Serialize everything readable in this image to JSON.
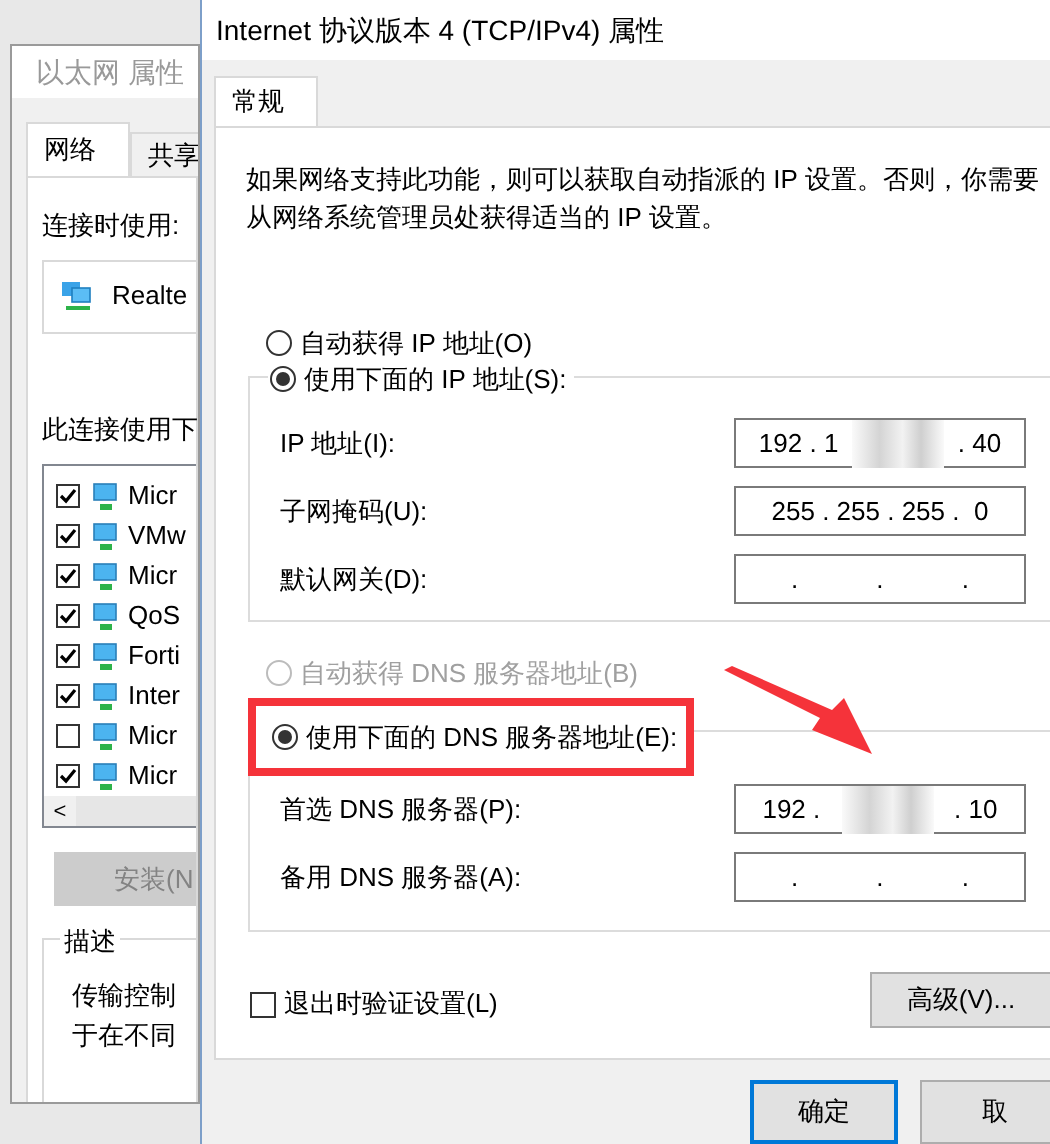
{
  "back_window": {
    "title": "以太网 属性",
    "tabs": [
      {
        "label": "网络",
        "selected": true
      },
      {
        "label": "共享",
        "selected": false
      }
    ],
    "connect_using_label": "连接时使用:",
    "adapter": "Realte",
    "items_label": "此连接使用下",
    "items": [
      {
        "label": "Micr",
        "checked": true
      },
      {
        "label": "VMw",
        "checked": true
      },
      {
        "label": "Micr",
        "checked": true
      },
      {
        "label": "QoS",
        "checked": true
      },
      {
        "label": "Forti",
        "checked": true
      },
      {
        "label": "Inter",
        "checked": true
      },
      {
        "label": "Micr",
        "checked": false
      },
      {
        "label": "Micr",
        "checked": true
      }
    ],
    "scroll_left": "<",
    "install_button": {
      "label": "安装(N",
      "disabled": true
    },
    "description_title": "描述",
    "description_lines": [
      "传输控制",
      "于在不同"
    ]
  },
  "dialog": {
    "title": "Internet 协议版本 4 (TCP/IPv4) 属性",
    "tabs": [
      {
        "label": "常规",
        "selected": true
      }
    ],
    "intro": "如果网络支持此功能，则可以获取自动指派的 IP 设置。否则，你需要从网络系统管理员处获得适当的 IP 设置。",
    "ip_options": [
      {
        "label": "自动获得 IP 地址(O)",
        "selected": false,
        "disabled": false
      },
      {
        "label": "使用下面的 IP 地址(S):",
        "selected": true,
        "disabled": false
      }
    ],
    "ip_fields": [
      {
        "label": "IP 地址(I):",
        "segments": [
          {
            "kind": "text",
            "text": "192 . 1"
          },
          {
            "kind": "blur"
          },
          {
            "kind": "text",
            "text": ". 40"
          }
        ]
      },
      {
        "label": "子网掩码(U):",
        "segments": [
          {
            "kind": "text",
            "text": "255 . 255 . 255 .  0"
          }
        ]
      },
      {
        "label": "默认网关(D):",
        "segments": [
          {
            "kind": "text",
            "text": "."
          },
          {
            "kind": "text",
            "text": "."
          },
          {
            "kind": "text",
            "text": "."
          }
        ]
      }
    ],
    "dns_options": [
      {
        "label": "自动获得 DNS 服务器地址(B)",
        "selected": false,
        "disabled": true
      },
      {
        "label": "使用下面的 DNS 服务器地址(E):",
        "selected": true,
        "disabled": false
      }
    ],
    "dns_choice_highlighted": true,
    "dns_fields": [
      {
        "label": "首选 DNS 服务器(P):",
        "segments": [
          {
            "kind": "text",
            "text": "192 ."
          },
          {
            "kind": "blur"
          },
          {
            "kind": "text",
            "text": ". 10"
          }
        ]
      },
      {
        "label": "备用 DNS 服务器(A):",
        "segments": [
          {
            "kind": "text",
            "text": "."
          },
          {
            "kind": "text",
            "text": "."
          },
          {
            "kind": "text",
            "text": "."
          }
        ]
      }
    ],
    "validate": {
      "label": "退出时验证设置(L)",
      "checked": false
    },
    "advanced_button": "高级(V)...",
    "buttons": [
      {
        "label": "确定",
        "default": true
      },
      {
        "label": "取",
        "default": false
      }
    ]
  }
}
